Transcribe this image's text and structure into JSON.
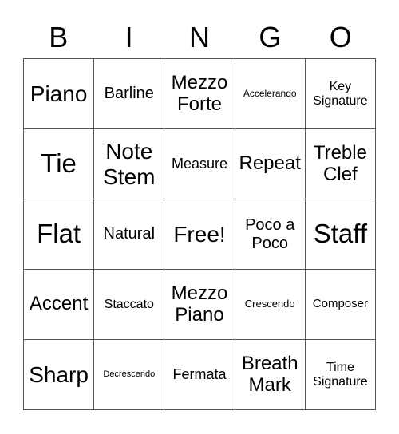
{
  "header": [
    "B",
    "I",
    "N",
    "G",
    "O"
  ],
  "cells": [
    "Piano",
    "Barline",
    "Mezzo Forte",
    "Accelerando",
    "Key Signature",
    "Tie",
    "Note Stem",
    "Measure",
    "Repeat",
    "Treble Clef",
    "Flat",
    "Natural",
    "Free!",
    "Poco a Poco",
    "Staff",
    "Accent",
    "Staccato",
    "Mezzo Piano",
    "Crescendo",
    "Composer",
    "Sharp",
    "Decrescendo",
    "Fermata",
    "Breath Mark",
    "Time Signature"
  ]
}
